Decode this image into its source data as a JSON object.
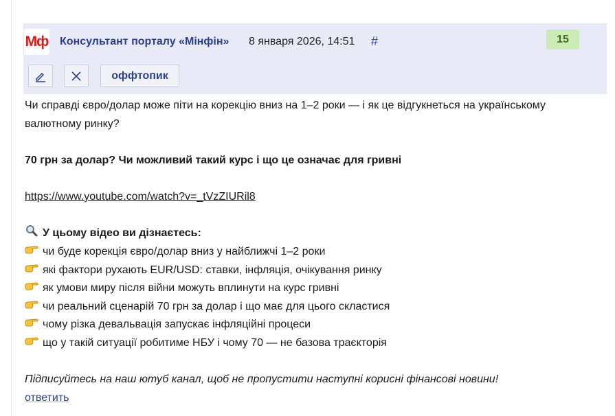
{
  "post": {
    "logo_text": "Мф",
    "author": "Консультант порталу «Мінфін»",
    "date": "8 января 2026, 14:51",
    "hash": "#",
    "score": "15",
    "offtopic_label": "оффтопик",
    "title_question": "Чи справді євро/долар може піти на корекцію вниз на 1–2 роки — і як це відгукнеться на українському валютному ринку?",
    "headline": "70 грн за долар? Чи можливий такий курс і що це означає для гривні",
    "video_link": "https://www.youtube.com/watch?v=_tVzZIURil8",
    "learn_heading": "У цьому відео ви дізнаєтесь:",
    "bullets": [
      "чи буде корекція євро/долар вниз у найближчі 1–2 роки",
      "які фактори рухають EUR/USD: ставки, інфляція, очікування ринку",
      "як умови миру після війни можуть вплинути на курс гривні",
      "чи реальний сценарій 70 грн за долар і що має для цього скластися",
      "чому різка девальвація запускає інфляційні процеси",
      "що у такій ситуації робитиме НБУ і чому 70 — не базова траєкторія"
    ],
    "subscribe_note": "Підписуйтесь на наш ютуб канал, щоб не пропустити наступні корисні фінансові новини!",
    "reply_label": "ответить"
  },
  "icons": {
    "learn_icon": "magnifier-icon",
    "bullet_icon": "pointing-hand-icon",
    "edit_icon": "pencil-icon",
    "delete_icon": "close-icon"
  },
  "colors": {
    "header_bg": "#e8eaf8",
    "author": "#2b3f8f",
    "logo": "#d7201a",
    "score_bg": "#cdebb7",
    "score_text": "#3f6d21"
  }
}
